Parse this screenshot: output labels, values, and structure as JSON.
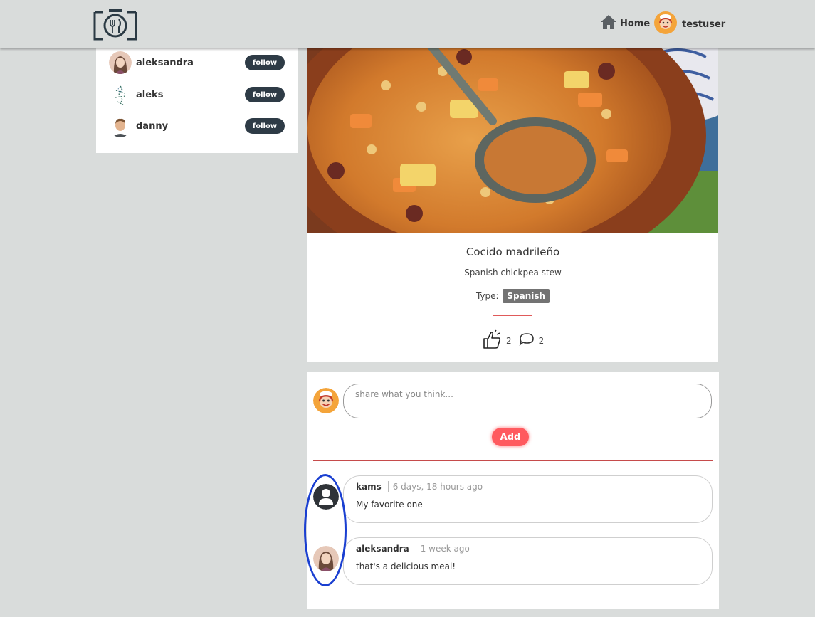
{
  "header": {
    "home_label": "Home",
    "username": "testuser"
  },
  "sidebar": {
    "suggestions": [
      {
        "name": "aleksandra",
        "button": "follow"
      },
      {
        "name": "aleks",
        "button": "follow"
      },
      {
        "name": "danny",
        "button": "follow"
      }
    ]
  },
  "recipe": {
    "title": "Cocido madrileño",
    "description": "Spanish chickpea stew",
    "type_label": "Type:",
    "type_value": "Spanish",
    "likes": "2",
    "comments_count": "2"
  },
  "comment_form": {
    "placeholder": "share what you think...",
    "add_label": "Add"
  },
  "comments": [
    {
      "author": "kams",
      "time": "6 days, 18 hours ago",
      "text": "My favorite one"
    },
    {
      "author": "aleksandra",
      "time": "1 week ago",
      "text": "that's a delicious meal!"
    }
  ],
  "colors": {
    "background": "#d9dcdb",
    "follow_button": "#2e3b46",
    "add_button": "#ff5a5f",
    "type_tag": "#737373",
    "highlight": "#1a3fd1"
  }
}
